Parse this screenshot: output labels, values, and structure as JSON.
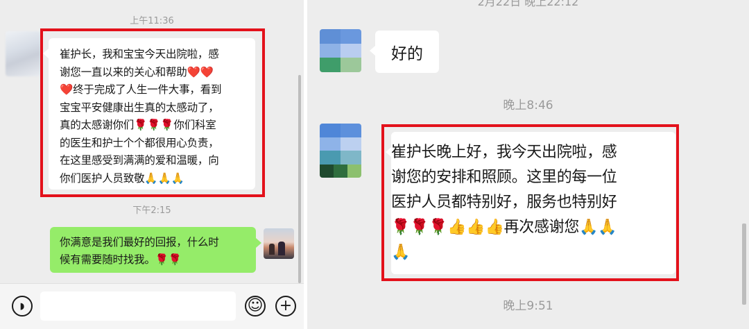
{
  "left_chat": {
    "timestamp_1": "上午11:36",
    "received_message": "崔护长，我和宝宝今天出院啦，感\n谢您一直以来的关心和帮助❤️❤️\n❤️终于完成了人生一件大事，看到\n宝宝平安健康出生真的太感动了，\n真的太感谢你们🌹🌹🌹你们科室\n的医生和护士个个都很用心负责，\n在这里感受到满满的爱和温暖，向\n你们医护人员致敬🙏🙏🙏",
    "timestamp_2": "下午2:15",
    "sent_message": "你满意是我们最好的回报，什么时\n候有需要随时找我。🌹🌹"
  },
  "right_chat": {
    "partial_timestamp": "2月22日 晚上22:12",
    "reply_message": "好的",
    "timestamp_1": "晚上8:46",
    "received_message": "崔护长晚上好，我今天出院啦，感\n谢您的安排和照顾。这里的每一位\n医护人员都特别好，服务也特别好\n🌹🌹🌹👍👍👍再次感谢您🙏🙏\n🙏",
    "timestamp_2": "晚上9:51"
  },
  "input_bar": {
    "voice_icon": "voice-icon",
    "emoji_icon": "emoji-icon",
    "plus_icon": "plus-icon",
    "voice_glyph": "◗",
    "emoji_glyph": "☺",
    "plus_glyph": "+"
  },
  "colors": {
    "chat_background": "#ededed",
    "sent_bubble": "#95ec69",
    "received_bubble": "#ffffff",
    "highlight_box": "#e3111b",
    "timestamp_text": "#9a9a9a"
  }
}
